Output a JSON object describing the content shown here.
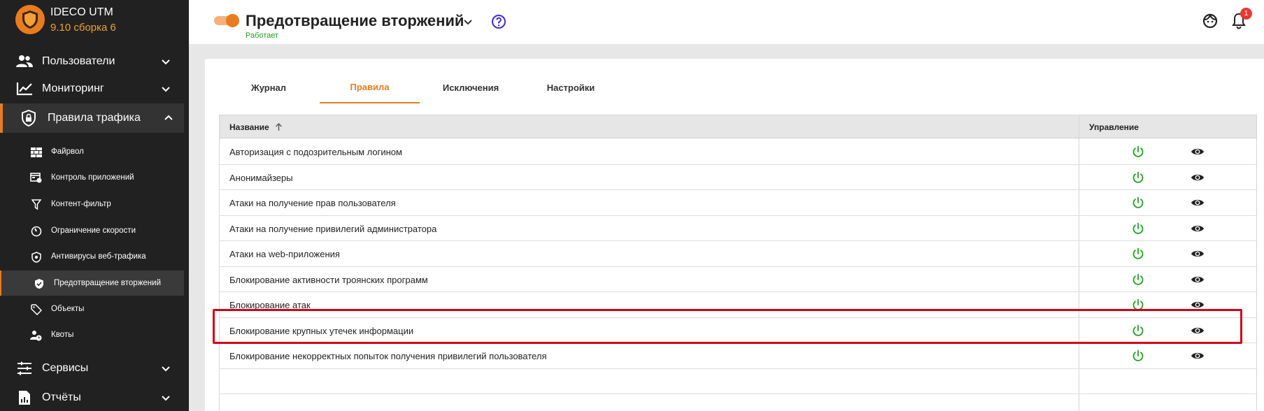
{
  "app": {
    "name": "IDECO UTM",
    "version": "9.10 сборка 6"
  },
  "sidebar": {
    "groups": [
      {
        "label": "Пользователи",
        "icon": "users-icon"
      },
      {
        "label": "Мониторинг",
        "icon": "chart-line-icon"
      },
      {
        "label": "Правила трафика",
        "icon": "shield-lock-icon"
      },
      {
        "label": "Сервисы",
        "icon": "sliders-icon"
      },
      {
        "label": "Отчёты",
        "icon": "report-icon"
      }
    ],
    "items": [
      {
        "label": "Файрвол",
        "icon": "brick-wall-icon"
      },
      {
        "label": "Контроль приложений",
        "icon": "app-control-icon"
      },
      {
        "label": "Контент-фильтр",
        "icon": "filter-icon"
      },
      {
        "label": "Ограничение скорости",
        "icon": "speedometer-icon"
      },
      {
        "label": "Антивирусы веб-трафика",
        "icon": "shield-icon"
      },
      {
        "label": "Предотвращение вторжений",
        "icon": "shield-check-icon"
      },
      {
        "label": "Объекты",
        "icon": "tag-icon"
      },
      {
        "label": "Квоты",
        "icon": "user-clock-icon"
      }
    ]
  },
  "header": {
    "title": "Предотвращение вторжений",
    "status": "Работает",
    "notifications_count": "1"
  },
  "tabs": [
    {
      "label": "Журнал"
    },
    {
      "label": "Правила"
    },
    {
      "label": "Исключения"
    },
    {
      "label": "Настройки"
    }
  ],
  "table": {
    "columns": {
      "name": "Название",
      "actions": "Управление"
    },
    "rows": [
      {
        "name": "Авторизация с подозрительным логином"
      },
      {
        "name": "Анонимайзеры"
      },
      {
        "name": "Атаки на получение прав пользователя"
      },
      {
        "name": "Атаки на получение привилегий администратора"
      },
      {
        "name": "Атаки на web-приложения"
      },
      {
        "name": "Блокирование активности троянских программ"
      },
      {
        "name": "Блокирование атак"
      },
      {
        "name": "Блокирование крупных утечек информации"
      },
      {
        "name": "Блокирование некорректных попыток получения привилегий пользователя"
      }
    ]
  },
  "colors": {
    "accent": "#e87c1e",
    "sidebar_bg": "#212121",
    "status_ok": "#21a021",
    "highlight": "#d0021b",
    "help": "#3d2de0"
  }
}
